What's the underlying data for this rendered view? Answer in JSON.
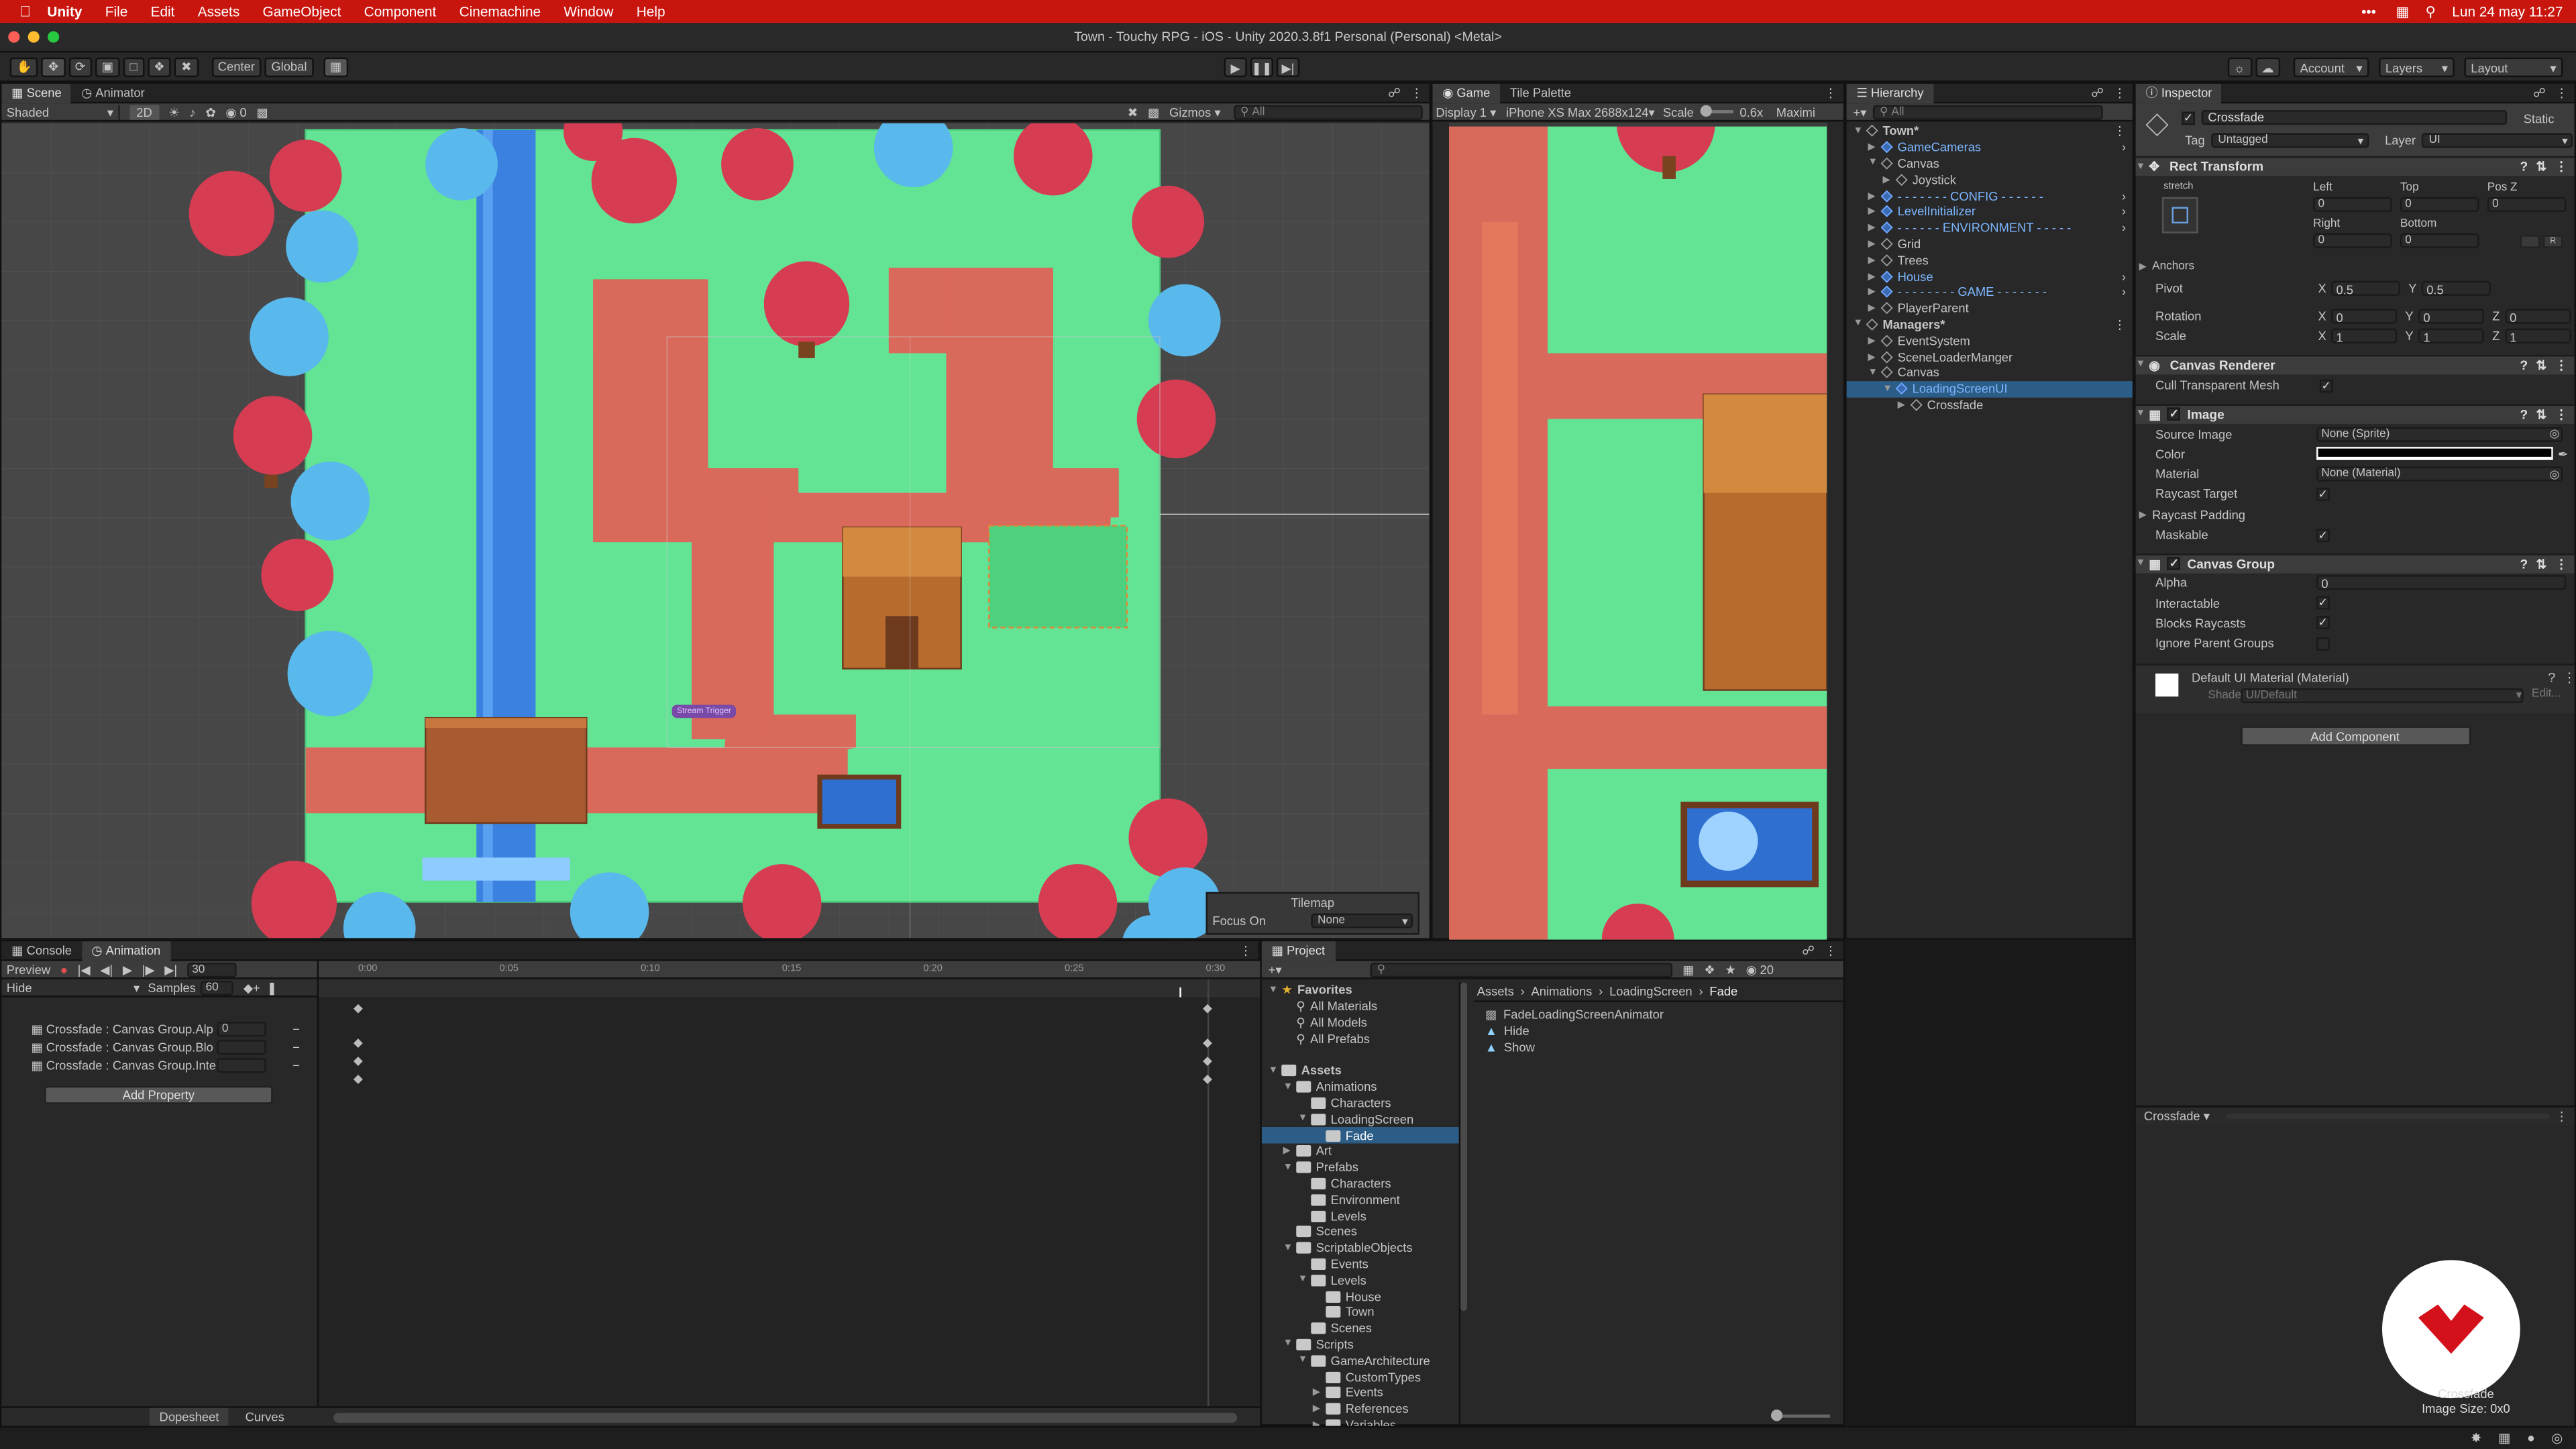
{
  "menubar": {
    "app": "Unity",
    "items": [
      "File",
      "Edit",
      "Assets",
      "GameObject",
      "Component",
      "Cinemachine",
      "Window",
      "Help"
    ],
    "datetime": "Lun 24 may  11:27",
    "dots": "•••"
  },
  "window": {
    "title": "Town - Touchy RPG - iOS - Unity 2020.3.8f1 Personal (Personal) <Metal>"
  },
  "toolbar": {
    "pivot": "Center",
    "space": "Global",
    "account": "Account",
    "layers": "Layers",
    "layout": "Layout"
  },
  "scene": {
    "tabs": [
      "Scene",
      "Animator"
    ],
    "shading": "Shaded",
    "mode2d": "2D",
    "gizmos": "Gizmos",
    "search": "All",
    "overlay_count": "0",
    "tilemap_title": "Tilemap",
    "focus_label": "Focus On",
    "focus_value": "None",
    "sprite_label": "Stream Trigger"
  },
  "game": {
    "tabs": [
      "Game",
      "Tile Palette"
    ],
    "display": "Display 1",
    "resolution": "iPhone XS Max 2688x124",
    "scale_label": "Scale",
    "scale_value": "0.6x",
    "maximize": "Maximi"
  },
  "hierarchy": {
    "title": "Hierarchy",
    "search": "All",
    "rows": [
      {
        "indent": 0,
        "label": "Town*",
        "kind": "scene",
        "open": true
      },
      {
        "indent": 1,
        "label": "GameCameras",
        "kind": "prefab",
        "open": false,
        "arrow": true
      },
      {
        "indent": 1,
        "label": "Canvas",
        "kind": "obj",
        "open": true
      },
      {
        "indent": 2,
        "label": "Joystick",
        "kind": "obj",
        "open": false
      },
      {
        "indent": 1,
        "label": "- - - - - - - CONFIG - - - - - -",
        "kind": "prefab",
        "open": false,
        "arrow": true
      },
      {
        "indent": 1,
        "label": "LevelInitializer",
        "kind": "prefab",
        "open": false,
        "arrow": true
      },
      {
        "indent": 1,
        "label": "- - - - - - ENVIRONMENT - - - - -",
        "kind": "prefab",
        "open": false,
        "arrow": true
      },
      {
        "indent": 1,
        "label": "Grid",
        "kind": "obj",
        "open": false
      },
      {
        "indent": 1,
        "label": "Trees",
        "kind": "obj",
        "open": false
      },
      {
        "indent": 1,
        "label": "House",
        "kind": "prefab",
        "open": false,
        "arrow": true
      },
      {
        "indent": 1,
        "label": "- - - - - - - - GAME - - - - - - -",
        "kind": "prefab",
        "open": false,
        "arrow": true
      },
      {
        "indent": 1,
        "label": "PlayerParent",
        "kind": "obj",
        "open": false
      },
      {
        "indent": 0,
        "label": "Managers*",
        "kind": "scene",
        "open": true
      },
      {
        "indent": 1,
        "label": "EventSystem",
        "kind": "obj",
        "open": false
      },
      {
        "indent": 1,
        "label": "SceneLoaderManger",
        "kind": "obj",
        "open": false
      },
      {
        "indent": 1,
        "label": "Canvas",
        "kind": "obj",
        "open": true
      },
      {
        "indent": 2,
        "label": "LoadingScreenUI",
        "kind": "prefab",
        "open": true,
        "selected": true
      },
      {
        "indent": 3,
        "label": "Crossfade",
        "kind": "obj",
        "open": false
      }
    ]
  },
  "inspector": {
    "title": "Inspector",
    "object_name": "Crossfade",
    "static": "Static",
    "tag_label": "Tag",
    "tag_value": "Untagged",
    "layer_label": "Layer",
    "layer_value": "UI",
    "rect": {
      "title": "Rect Transform",
      "stretch": "stretch",
      "left_label": "Left",
      "top_label": "Top",
      "posz_label": "Pos Z",
      "left": "0",
      "top": "0",
      "posz": "0",
      "right_label": "Right",
      "bottom_label": "Bottom",
      "right": "0",
      "bottom": "0",
      "anchors": "Anchors",
      "pivot": "Pivot",
      "pivot_x": "0.5",
      "pivot_y": "0.5",
      "rotation": "Rotation",
      "rot_x": "0",
      "rot_y": "0",
      "rot_z": "0",
      "scale": "Scale",
      "scale_x": "1",
      "scale_y": "1",
      "scale_z": "1",
      "axis_x": "X",
      "axis_y": "Y",
      "axis_z": "Z",
      "r_btn": "R"
    },
    "canvas_renderer": {
      "title": "Canvas Renderer",
      "cull": "Cull Transparent Mesh"
    },
    "image": {
      "title": "Image",
      "source": "Source Image",
      "source_value": "None (Sprite)",
      "color": "Color",
      "material": "Material",
      "material_value": "None (Material)",
      "raycast_target": "Raycast Target",
      "raycast_padding": "Raycast Padding",
      "maskable": "Maskable"
    },
    "canvas_group": {
      "title": "Canvas Group",
      "alpha": "Alpha",
      "alpha_value": "0",
      "interactable": "Interactable",
      "blocks": "Blocks Raycasts",
      "ignore": "Ignore Parent Groups"
    },
    "material": {
      "title": "Default UI Material (Material)",
      "shader": "Shader",
      "shader_value": "UI/Default",
      "edit": "Edit..."
    },
    "add_component": "Add Component",
    "preview_label": "Crossfade",
    "preview_caption": "Crossfade",
    "preview_size": "Image Size: 0x0"
  },
  "animation": {
    "tabs": [
      "Console",
      "Animation"
    ],
    "preview": "Preview",
    "frame": "30",
    "clip": "Hide",
    "samples_label": "Samples",
    "samples": "60",
    "ticks": [
      "0:00",
      "0:05",
      "0:10",
      "0:15",
      "0:20",
      "0:25",
      "0:30"
    ],
    "properties": [
      {
        "label": "Crossfade : Canvas Group.Alp",
        "value": "0"
      },
      {
        "label": "Crossfade : Canvas Group.Blo",
        "value": ""
      },
      {
        "label": "Crossfade : Canvas Group.Inte",
        "value": ""
      }
    ],
    "add_property": "Add Property",
    "dopesheet": "Dopesheet",
    "curves": "Curves"
  },
  "project": {
    "title": "Project",
    "count": "20",
    "breadcrumb": [
      "Assets",
      "Animations",
      "LoadingScreen",
      "Fade"
    ],
    "files": [
      {
        "label": "FadeLoadingScreenAnimator",
        "kind": "animator"
      },
      {
        "label": "Hide",
        "kind": "anim"
      },
      {
        "label": "Show",
        "kind": "anim"
      }
    ],
    "tree": [
      {
        "indent": 0,
        "label": "Favorites",
        "kind": "star",
        "open": true
      },
      {
        "indent": 1,
        "label": "All Materials",
        "kind": "search"
      },
      {
        "indent": 1,
        "label": "All Models",
        "kind": "search"
      },
      {
        "indent": 1,
        "label": "All Prefabs",
        "kind": "search"
      },
      {
        "indent": 0,
        "label": "",
        "kind": "spacer"
      },
      {
        "indent": 0,
        "label": "Assets",
        "kind": "folder",
        "open": true
      },
      {
        "indent": 1,
        "label": "Animations",
        "kind": "folder",
        "open": true
      },
      {
        "indent": 2,
        "label": "Characters",
        "kind": "folder"
      },
      {
        "indent": 2,
        "label": "LoadingScreen",
        "kind": "folder",
        "open": true
      },
      {
        "indent": 3,
        "label": "Fade",
        "kind": "folder",
        "selected": true
      },
      {
        "indent": 1,
        "label": "Art",
        "kind": "folder",
        "closed": true
      },
      {
        "indent": 1,
        "label": "Prefabs",
        "kind": "folder",
        "open": true
      },
      {
        "indent": 2,
        "label": "Characters",
        "kind": "folder"
      },
      {
        "indent": 2,
        "label": "Environment",
        "kind": "folder"
      },
      {
        "indent": 2,
        "label": "Levels",
        "kind": "folder"
      },
      {
        "indent": 1,
        "label": "Scenes",
        "kind": "folder"
      },
      {
        "indent": 1,
        "label": "ScriptableObjects",
        "kind": "folder",
        "open": true
      },
      {
        "indent": 2,
        "label": "Events",
        "kind": "folder"
      },
      {
        "indent": 2,
        "label": "Levels",
        "kind": "folder",
        "open": true
      },
      {
        "indent": 3,
        "label": "House",
        "kind": "folder"
      },
      {
        "indent": 3,
        "label": "Town",
        "kind": "folder"
      },
      {
        "indent": 2,
        "label": "Scenes",
        "kind": "folder"
      },
      {
        "indent": 1,
        "label": "Scripts",
        "kind": "folder",
        "open": true
      },
      {
        "indent": 2,
        "label": "GameArchitecture",
        "kind": "folder",
        "open": true
      },
      {
        "indent": 3,
        "label": "CustomTypes",
        "kind": "folder"
      },
      {
        "indent": 3,
        "label": "Events",
        "kind": "folder",
        "closed": true
      },
      {
        "indent": 3,
        "label": "References",
        "kind": "folder",
        "closed": true
      },
      {
        "indent": 3,
        "label": "Variables",
        "kind": "folder",
        "closed": true
      }
    ]
  },
  "colors": {
    "mac_red": "#c8160f",
    "grass": "#63e394",
    "path": "#d9695a",
    "water": "#3b82e0",
    "tree_red": "#d63c52",
    "tree_blue": "#59b8ec",
    "selection": "#2c5d87"
  }
}
